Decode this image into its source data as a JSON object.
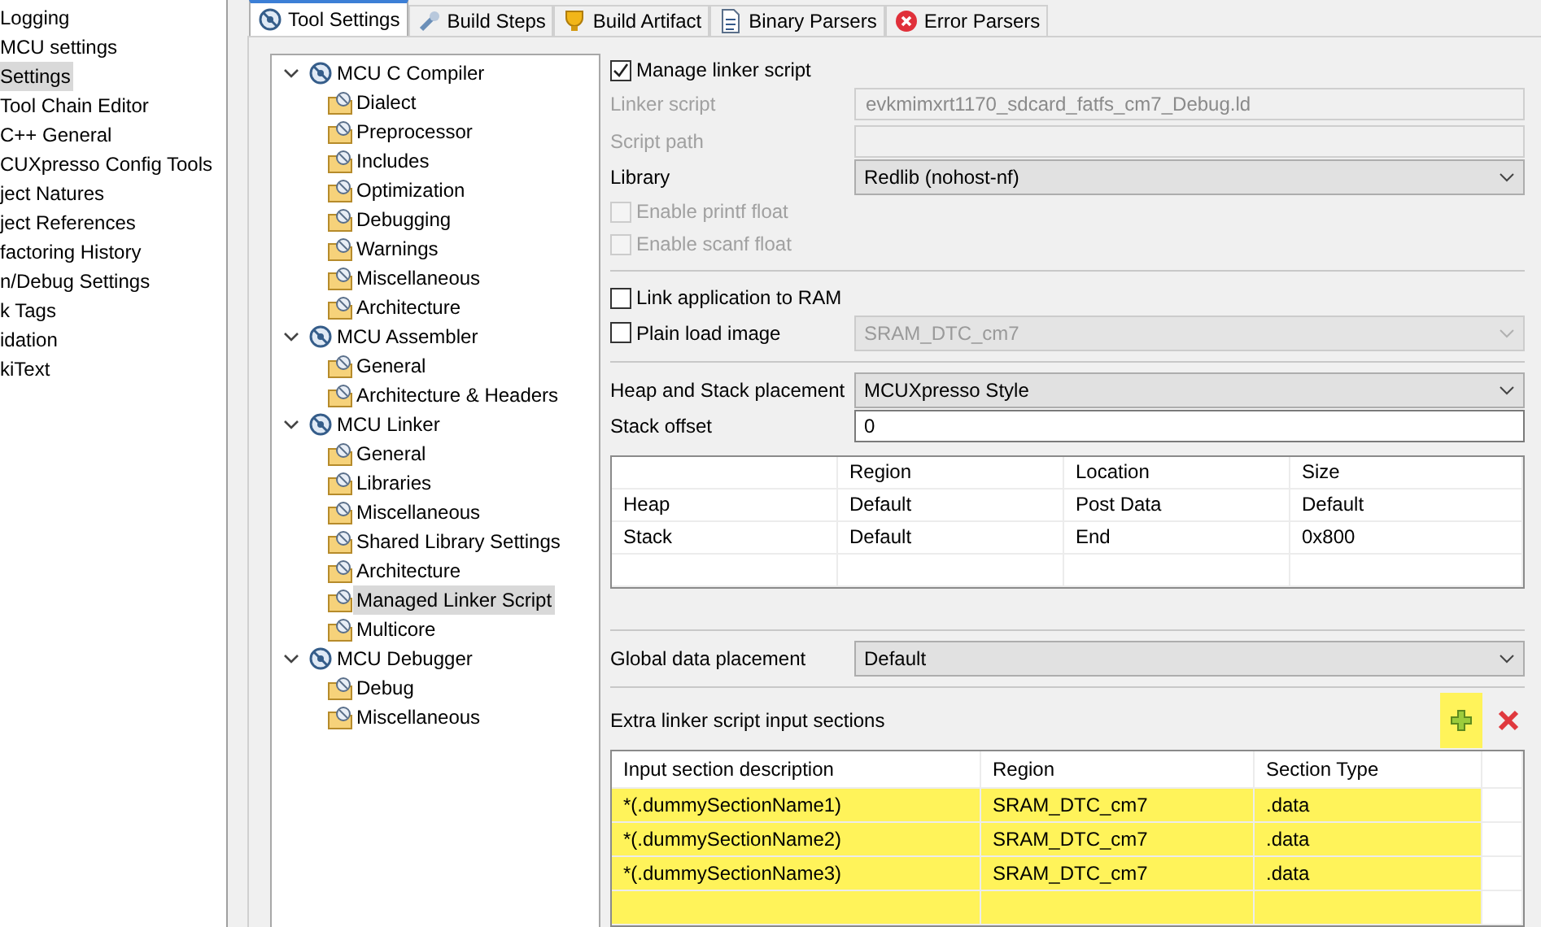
{
  "sidebar": {
    "items": [
      {
        "label": "Logging",
        "selected": false
      },
      {
        "label": "MCU settings",
        "selected": false
      },
      {
        "label": "Settings",
        "selected": true
      },
      {
        "label": "Tool Chain Editor",
        "selected": false
      },
      {
        "label": "C++ General",
        "selected": false
      },
      {
        "label": "CUXpresso Config Tools",
        "selected": false
      },
      {
        "label": "ject Natures",
        "selected": false
      },
      {
        "label": "ject References",
        "selected": false
      },
      {
        "label": "factoring History",
        "selected": false
      },
      {
        "label": "n/Debug Settings",
        "selected": false
      },
      {
        "label": "k Tags",
        "selected": false
      },
      {
        "label": "idation",
        "selected": false
      },
      {
        "label": "kiText",
        "selected": false
      }
    ]
  },
  "tabs": [
    {
      "label": "Tool Settings",
      "selected": true
    },
    {
      "label": "Build Steps",
      "selected": false
    },
    {
      "label": "Build Artifact",
      "selected": false
    },
    {
      "label": "Binary Parsers",
      "selected": false
    },
    {
      "label": "Error Parsers",
      "selected": false
    }
  ],
  "tree": [
    {
      "label": "MCU C Compiler",
      "expanded": true,
      "selected": false,
      "children": [
        {
          "label": "Dialect",
          "selected": false
        },
        {
          "label": "Preprocessor",
          "selected": false
        },
        {
          "label": "Includes",
          "selected": false
        },
        {
          "label": "Optimization",
          "selected": false
        },
        {
          "label": "Debugging",
          "selected": false
        },
        {
          "label": "Warnings",
          "selected": false
        },
        {
          "label": "Miscellaneous",
          "selected": false
        },
        {
          "label": "Architecture",
          "selected": false
        }
      ]
    },
    {
      "label": "MCU Assembler",
      "expanded": true,
      "selected": false,
      "children": [
        {
          "label": "General",
          "selected": false
        },
        {
          "label": "Architecture & Headers",
          "selected": false
        }
      ]
    },
    {
      "label": "MCU Linker",
      "expanded": true,
      "selected": false,
      "children": [
        {
          "label": "General",
          "selected": false
        },
        {
          "label": "Libraries",
          "selected": false
        },
        {
          "label": "Miscellaneous",
          "selected": false
        },
        {
          "label": "Shared Library Settings",
          "selected": false
        },
        {
          "label": "Architecture",
          "selected": false
        },
        {
          "label": "Managed Linker Script",
          "selected": true
        },
        {
          "label": "Multicore",
          "selected": false
        }
      ]
    },
    {
      "label": "MCU Debugger",
      "expanded": true,
      "selected": false,
      "children": [
        {
          "label": "Debug",
          "selected": false
        },
        {
          "label": "Miscellaneous",
          "selected": false
        }
      ]
    }
  ],
  "settings": [
    {
      "kind": "checkbox",
      "label": "Manage linker script",
      "checked": true,
      "disabled": false
    },
    {
      "kind": "field",
      "label": "Linker script",
      "value": "evkmimxrt1170_sdcard_fatfs_cm7_Debug.ld",
      "disabled": true
    },
    {
      "kind": "field",
      "label": "Script path",
      "disabled": true
    },
    {
      "kind": "combo",
      "label": "Library",
      "value": "Redlib (nohost-nf)",
      "disabled": false
    },
    {
      "kind": "checkbox",
      "label": "Enable printf float",
      "checked": false,
      "disabled": true
    },
    {
      "kind": "checkbox",
      "label": "Enable scanf float",
      "checked": false,
      "disabled": true
    },
    {
      "kind": "separator"
    },
    {
      "kind": "checkbox",
      "label": "Link application to RAM",
      "checked": false,
      "disabled": false
    },
    {
      "kind": "checkcombo",
      "label": "Plain load image",
      "checked": false,
      "value": "SRAM_DTC_cm7",
      "disabled": true
    },
    {
      "kind": "separator"
    },
    {
      "kind": "combo",
      "label": "Heap and Stack placement",
      "value": "MCUXpresso Style",
      "disabled": false
    },
    {
      "kind": "input",
      "label": "Stack offset",
      "value": "0",
      "disabled": false
    }
  ],
  "heap_stack_table": {
    "columns": [
      "Region",
      "Location",
      "Size"
    ],
    "rows": [
      {
        "name": "Heap",
        "cells": [
          "Default",
          "Post Data",
          "Default"
        ]
      },
      {
        "name": "Stack",
        "cells": [
          "Default",
          "End",
          "0x800"
        ]
      }
    ]
  },
  "global_data": {
    "label": "Global data placement",
    "value": "Default"
  },
  "extra_sections": {
    "label": "Extra linker script input sections",
    "add_highlighted": true,
    "columns": [
      "Input section description",
      "Region",
      "Section Type"
    ],
    "rows": [
      {
        "cells": [
          "*(.dummySectionName1)",
          "SRAM_DTC_cm7",
          ".data"
        ],
        "highlighted": true
      },
      {
        "cells": [
          "*(.dummySectionName2)",
          "SRAM_DTC_cm7",
          ".data"
        ],
        "highlighted": true
      },
      {
        "cells": [
          "*(.dummySectionName3)",
          "SRAM_DTC_cm7",
          ".data"
        ],
        "highlighted": true
      }
    ]
  }
}
